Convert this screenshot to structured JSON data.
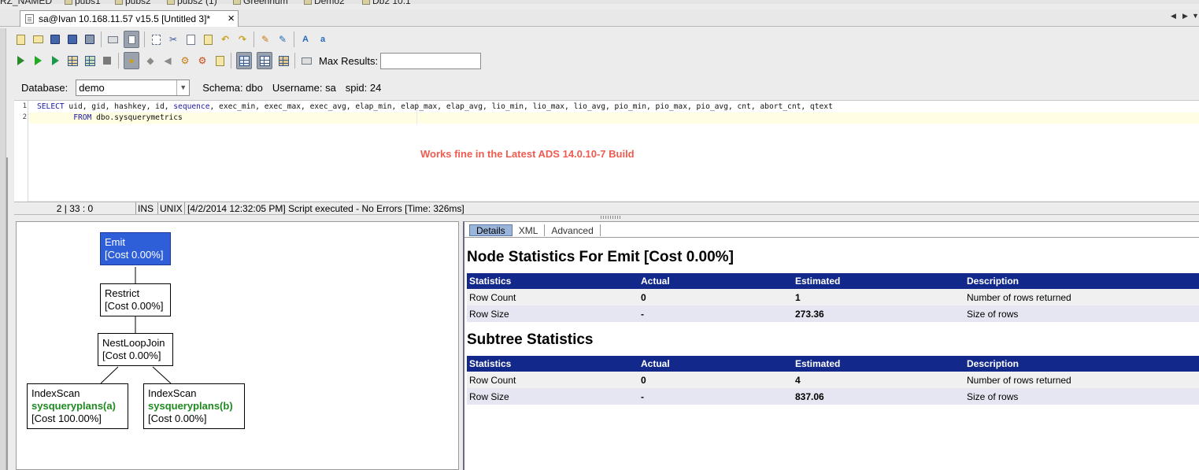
{
  "top_tabs": [
    "RZ_NAMED",
    "pubs1",
    "pubs2",
    "pubs2 (1)",
    "Greenrlum",
    "Demo2",
    "Db2 10.1"
  ],
  "editor_tab": {
    "title": "sa@Ivan 10.168.11.57 v15.5 [Untitled 3]*",
    "close": "×"
  },
  "tab_nav": {
    "prev": "◀",
    "next": "▶",
    "menu": "▼"
  },
  "toolbar": {
    "max_results_label": "Max Results:",
    "max_results_value": ""
  },
  "connection": {
    "database_label": "Database:",
    "database_value": "demo",
    "schema": "Schema:  dbo",
    "username": "Username:  sa",
    "spid": "spid:  24"
  },
  "editor": {
    "line_numbers": [
      "1",
      "2"
    ],
    "line1_a": "SELECT",
    "line1_b": " uid, gid, hashkey, id, ",
    "line1_c": "sequence",
    "line1_d": ", exec_min, exec_max, exec_avg, elap_min, elap_max, elap_avg, lio_min, lio_max, lio_avg, pio_min, pio_max, pio_avg, cnt, abort_cnt, qtext",
    "line2_a": "        FROM",
    "line2_b": " dbo.sysquerymetrics",
    "note": "Works fine in the Latest ADS 14.0.10-7 Build"
  },
  "status": {
    "position": "2 | 33 : 0",
    "mode": "INS",
    "eol": "UNIX",
    "message": "[4/2/2014 12:32:05 PM] Script executed - No Errors [Time: 326ms]"
  },
  "plan": {
    "emit": {
      "name": "Emit",
      "cost": "[Cost 0.00%]"
    },
    "restrict": {
      "name": "Restrict",
      "cost": "[Cost 0.00%]"
    },
    "nlj": {
      "name": "NestLoopJoin",
      "cost": "[Cost 0.00%]"
    },
    "scan_a": {
      "name": "IndexScan",
      "table": "sysqueryplans(a)",
      "cost": "[Cost 100.00%]"
    },
    "scan_b": {
      "name": "IndexScan",
      "table": "sysqueryplans(b)",
      "cost": "[Cost 0.00%]"
    }
  },
  "details": {
    "tabs": [
      "Details",
      "XML",
      "Advanced"
    ],
    "node_heading": "Node Statistics For Emit [Cost 0.00%]",
    "subtree_heading": "Subtree Statistics",
    "columns": [
      "Statistics",
      "Actual",
      "Estimated",
      "Description"
    ],
    "node_rows": [
      [
        "Row Count",
        "0",
        "1",
        "Number of rows returned"
      ],
      [
        "Row Size",
        "-",
        "273.36",
        "Size of rows"
      ]
    ],
    "subtree_rows": [
      [
        "Row Count",
        "0",
        "4",
        "Number of rows returned"
      ],
      [
        "Row Size",
        "-",
        "837.06",
        "Size of rows"
      ]
    ]
  },
  "colors": {
    "selected_node": "#2f5fd8",
    "table_header": "#12288a",
    "note": "#ee5c50",
    "table_name": "#1f8a1f"
  }
}
